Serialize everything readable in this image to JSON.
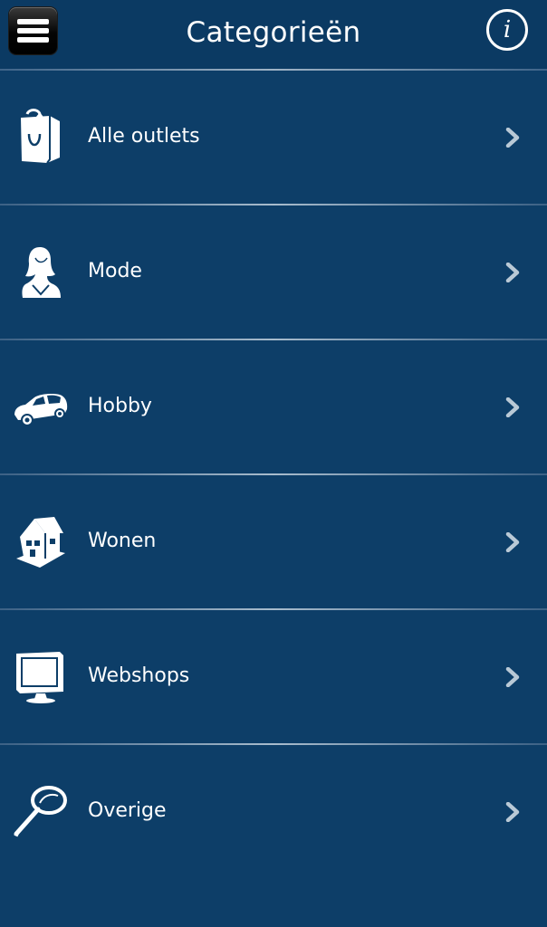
{
  "header": {
    "title": "Categorieën",
    "menu_icon": "hamburger-menu-icon",
    "info_label": "i"
  },
  "categories": [
    {
      "label": "Alle outlets",
      "icon": "shopping-bag-icon"
    },
    {
      "label": "Mode",
      "icon": "woman-bust-icon"
    },
    {
      "label": "Hobby",
      "icon": "car-icon"
    },
    {
      "label": "Wonen",
      "icon": "house-icon"
    },
    {
      "label": "Webshops",
      "icon": "monitor-icon"
    },
    {
      "label": "Overige",
      "icon": "magnifier-icon"
    }
  ],
  "colors": {
    "background": "#0d3e68",
    "separator": "#a8bccd",
    "text": "#ffffff"
  }
}
